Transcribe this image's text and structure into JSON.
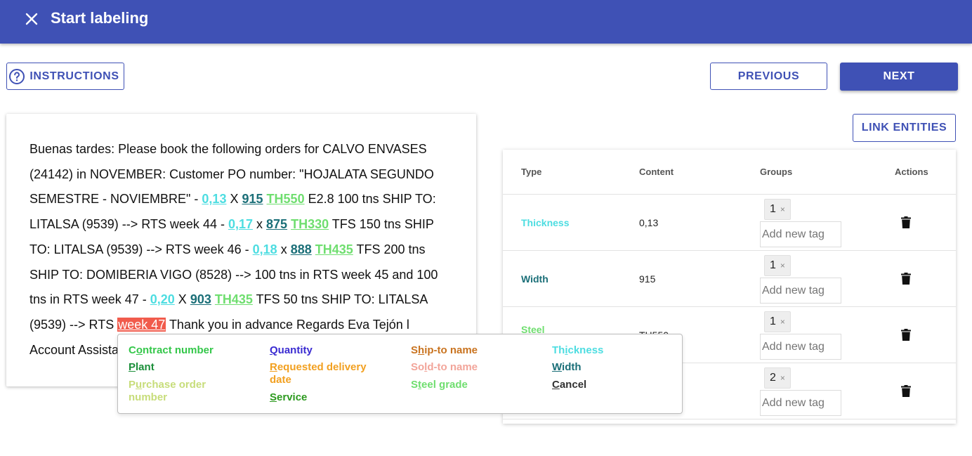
{
  "header": {
    "title": "Start labeling",
    "close_icon": "close-icon"
  },
  "toolbar": {
    "instructions_label": "Instructions",
    "previous_label": "Previous",
    "next_label": "Next",
    "link_entities_label": "Link entities"
  },
  "colors": {
    "primary": "#3f51b5",
    "thickness": "#4ddde1",
    "width": "#1b6f78",
    "steel_grade": "#6fde6f",
    "selected": "#f15b4c"
  },
  "document": {
    "t1": "Buenas tardes: Please book the following orders for CALVO ENVASES (24142) in NOVEMBER: Customer PO number: \"HOJALATA SEGUNDO SEMESTRE - NOVIEMBRE\" - ",
    "e1": "0,13",
    "t2": " X ",
    "e2": "915",
    "t3": " ",
    "e3": "TH550",
    "t4": " E2.8 100 tns SHIP TO: LITALSA (9539) --> RTS week 44 - ",
    "e4": "0,17",
    "t5": " x ",
    "e5": "875",
    "t6": " ",
    "e6": "TH330",
    "t7": " TFS 150 tns SHIP TO: LITALSA (9539) --> RTS week 46 - ",
    "e7": "0,18",
    "t8": " x ",
    "e8": "888",
    "t9": " ",
    "e9": "TH435",
    "t10": " TFS 200 tns SHIP TO: DOMIBERIA VIGO (8528) --> 100 tns in RTS week 45 and 100 tns in RTS week 47 - ",
    "e10": "0,20",
    "t11": " X ",
    "e11": "903",
    "t12": " ",
    "e12": "TH435",
    "t13": " TFS 50 tns SHIP TO: LITALSA (9539) --> RTS ",
    "selected": "week 47",
    "t14": " Thank you in advance Regards Eva Tejón l Account Assistant"
  },
  "table": {
    "headers": {
      "type": "Type",
      "content": "Content",
      "groups": "Groups",
      "actions": "Actions"
    },
    "rows": [
      {
        "type": "Thickness",
        "content": "0,13",
        "group": "1",
        "placeholder": "Add new tag"
      },
      {
        "type": "Width",
        "content": "915",
        "group": "1",
        "placeholder": "Add new tag"
      },
      {
        "type": "Steel",
        "content": "TH550",
        "group": "1",
        "placeholder": "Add new tag"
      },
      {
        "type": "",
        "content": "",
        "group": "2",
        "placeholder": "Add new tag"
      }
    ],
    "chip_remove": "×"
  },
  "popup": {
    "items": [
      {
        "pre": "C",
        "key": "o",
        "post": "ntract number",
        "color": "#34c74a"
      },
      {
        "pre": "",
        "key": "P",
        "post": "lant",
        "color": "#1b8f3a"
      },
      {
        "pre": "P",
        "key": "u",
        "post": "rchase order number",
        "color": "#c7dd7a"
      },
      {
        "pre": "",
        "key": "Q",
        "post": "uantity",
        "color": "#3a2bd1"
      },
      {
        "pre": "",
        "key": "R",
        "post": "equested delivery date",
        "color": "#f2a020"
      },
      {
        "pre": "",
        "key": "S",
        "post": "ervice",
        "color": "#2d9a1f"
      },
      {
        "pre": "S",
        "key": "h",
        "post": "ip-to name",
        "color": "#c9731f"
      },
      {
        "pre": "So",
        "key": "l",
        "post": "d-to name",
        "color": "#f2a59a"
      },
      {
        "pre": "S",
        "key": "t",
        "post": "eel grade",
        "color": "#6fde6f"
      },
      {
        "pre": "Th",
        "key": "i",
        "post": "ckness",
        "color": "#4ddde1"
      },
      {
        "pre": "",
        "key": "W",
        "post": "idth",
        "color": "#1b6f78"
      },
      {
        "pre": "",
        "key": "C",
        "post": "ancel",
        "color": "#333333"
      }
    ]
  }
}
